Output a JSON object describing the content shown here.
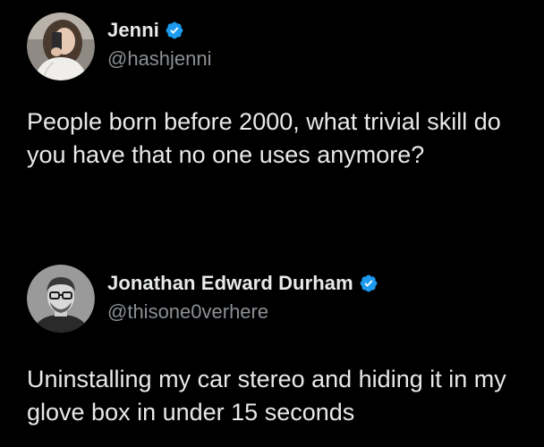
{
  "tweets": [
    {
      "author": {
        "display_name": "Jenni",
        "handle": "@hashjenni",
        "verified": true,
        "avatar_icon": "avatar-woman-selfie"
      },
      "text": "People born before 2000, what trivial skill do you have that no one uses anymore?"
    },
    {
      "author": {
        "display_name": "Jonathan Edward Durham",
        "handle": "@thisone0verhere",
        "verified": true,
        "avatar_icon": "avatar-man-glasses"
      },
      "text": "Uninstalling my car stereo and hiding it in my glove box in under 15 seconds"
    }
  ],
  "colors": {
    "background": "#000000",
    "primary_text": "#e7e9ea",
    "secondary_text": "#8b8f94",
    "verified_badge": "#1d9bf0"
  }
}
